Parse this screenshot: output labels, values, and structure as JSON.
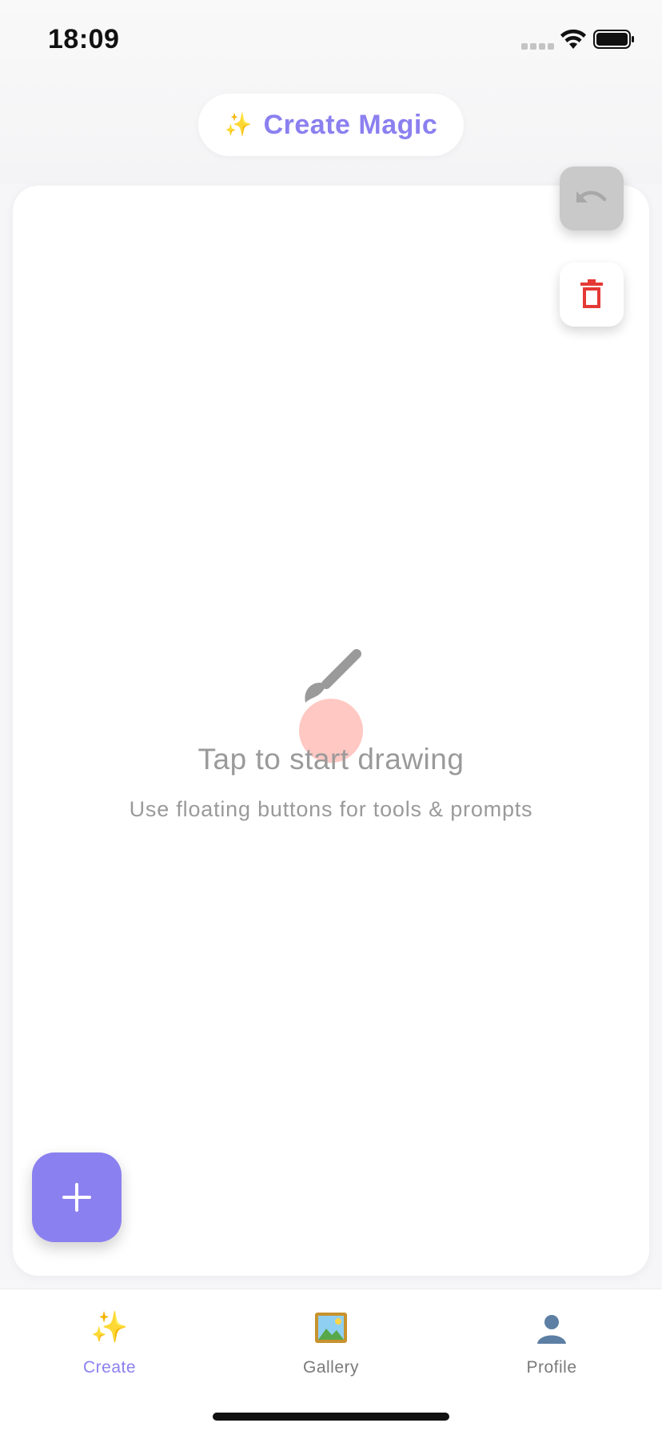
{
  "status_bar": {
    "time": "18:09"
  },
  "header": {
    "title": "Create Magic",
    "icon": "sparkles-icon"
  },
  "canvas": {
    "empty_title": "Tap to start drawing",
    "empty_subtitle": "Use floating buttons for tools & prompts",
    "empty_icon": "paintbrush-icon"
  },
  "floating_buttons": {
    "undo_icon": "undo-icon",
    "delete_icon": "trash-icon",
    "add_icon": "plus-icon"
  },
  "tab_bar": {
    "tabs": [
      {
        "label": "Create",
        "icon": "sparkles-icon",
        "active": true
      },
      {
        "label": "Gallery",
        "icon": "picture-icon",
        "active": false
      },
      {
        "label": "Profile",
        "icon": "person-icon",
        "active": false
      }
    ]
  },
  "colors": {
    "accent": "#8b80ef",
    "danger": "#e53935",
    "sparkle": "#f5c542"
  }
}
